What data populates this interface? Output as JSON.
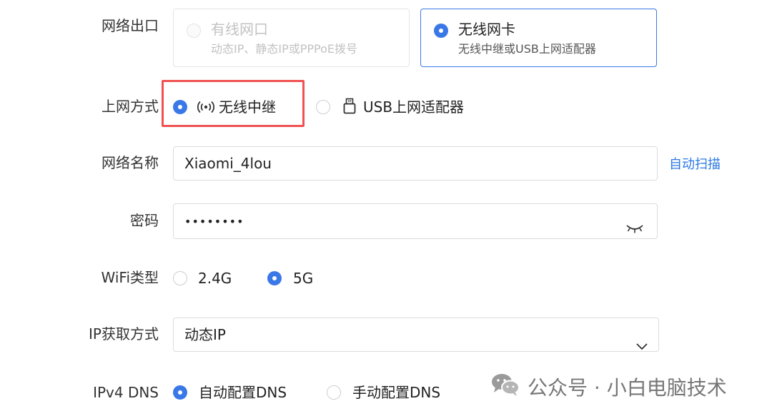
{
  "network_output": {
    "label": "网络出口",
    "options": [
      {
        "title": "有线网口",
        "subtitle": "动态IP、静态IP或PPPoE拨号",
        "selected": false,
        "disabled": true
      },
      {
        "title": "无线网卡",
        "subtitle": "无线中继或USB上网适配器",
        "selected": true,
        "disabled": false
      }
    ]
  },
  "connection_mode": {
    "label": "上网方式",
    "options": [
      {
        "label": "无线中继",
        "icon": "wireless-signal-icon",
        "selected": true
      },
      {
        "label": "USB上网适配器",
        "icon": "usb-icon",
        "selected": false
      }
    ]
  },
  "network_name": {
    "label": "网络名称",
    "value": "Xiaomi_4lou",
    "scan_link": "自动扫描"
  },
  "password": {
    "label": "密码",
    "value": "••••••••",
    "toggle_icon": "eye-closed-icon"
  },
  "wifi_type": {
    "label": "WiFi类型",
    "options": [
      {
        "label": "2.4G",
        "selected": false
      },
      {
        "label": "5G",
        "selected": true
      }
    ]
  },
  "ip_mode": {
    "label": "IP获取方式",
    "value": "动态IP",
    "icon": "chevron-down-icon"
  },
  "dns": {
    "label": "IPv4 DNS",
    "options": [
      {
        "label": "自动配置DNS",
        "selected": true
      },
      {
        "label": "手动配置DNS",
        "selected": false
      }
    ]
  },
  "watermark": {
    "text": "公众号 · 小白电脑技术",
    "icon": "wechat-icon"
  },
  "colors": {
    "accent": "#3b78e7",
    "highlight_box": "#f05151",
    "link": "#2b78e4"
  }
}
